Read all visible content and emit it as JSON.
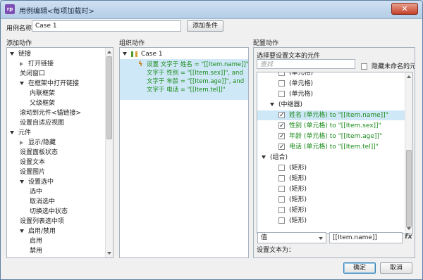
{
  "window": {
    "title": "用例编辑<每项加载时>",
    "app_icon": "rp",
    "close_glyph": "✕"
  },
  "case": {
    "name_label": "用例名称",
    "name_value": "Case 1",
    "add_condition": "添加条件"
  },
  "sections": {
    "add_action": "添加动作",
    "organize_action": "组织动作",
    "configure_action": "配置动作"
  },
  "actions_tree": [
    {
      "label": "链接",
      "level": 0,
      "toggle": "down"
    },
    {
      "label": "打开链接",
      "level": 1,
      "toggle": "right"
    },
    {
      "label": "关闭窗口",
      "level": 1,
      "toggle": "none"
    },
    {
      "label": "在框架中打开链接",
      "level": 1,
      "toggle": "down"
    },
    {
      "label": "内联框架",
      "level": 2,
      "toggle": "none"
    },
    {
      "label": "父级框架",
      "level": 2,
      "toggle": "none"
    },
    {
      "label": "滚动到元件<锚链接>",
      "level": 1,
      "toggle": "none"
    },
    {
      "label": "设置自适应视图",
      "level": 1,
      "toggle": "none"
    },
    {
      "label": "元件",
      "level": 0,
      "toggle": "down"
    },
    {
      "label": "显示/隐藏",
      "level": 1,
      "toggle": "right"
    },
    {
      "label": "设置面板状态",
      "level": 1,
      "toggle": "none"
    },
    {
      "label": "设置文本",
      "level": 1,
      "toggle": "none"
    },
    {
      "label": "设置图片",
      "level": 1,
      "toggle": "none"
    },
    {
      "label": "设置选中",
      "level": 1,
      "toggle": "down"
    },
    {
      "label": "选中",
      "level": 2,
      "toggle": "none"
    },
    {
      "label": "取消选中",
      "level": 2,
      "toggle": "none"
    },
    {
      "label": "切换选中状态",
      "level": 2,
      "toggle": "none"
    },
    {
      "label": "设置列表选中项",
      "level": 1,
      "toggle": "none"
    },
    {
      "label": "启用/禁用",
      "level": 1,
      "toggle": "down"
    },
    {
      "label": "启用",
      "level": 2,
      "toggle": "none"
    },
    {
      "label": "禁用",
      "level": 2,
      "toggle": "none"
    }
  ],
  "organize": {
    "case_label": "Case 1",
    "action_lines": [
      "设置 文字于 姓名 = \"[[Item.name]]\", and",
      "文字于 性别 = \"[[Item.sex]]\", and",
      "文字于 年龄 = \"[[Item.age]]\", and",
      "文字于 电话 = \"[[Item.tel]]\""
    ]
  },
  "configure": {
    "select_label": "选择要设置文本的元件",
    "search_placeholder": "查找",
    "hide_unnamed": "隐藏未命名的元件",
    "items": [
      {
        "label": "(单元格)",
        "level": 2,
        "checkbox": true,
        "checked": false,
        "partial": true
      },
      {
        "label": "(单元格)",
        "level": 2,
        "checkbox": true,
        "checked": false
      },
      {
        "label": "(单元格)",
        "level": 2,
        "checkbox": true,
        "checked": false
      },
      {
        "label": "(中继器)",
        "level": 1,
        "checkbox": false,
        "toggle": "down"
      },
      {
        "label": "姓名 (单元格) to \"[[Item.name]]\"",
        "level": 2,
        "checkbox": true,
        "checked": true,
        "selected": true
      },
      {
        "label": "性别 (单元格) to \"[[Item.sex]]\"",
        "level": 2,
        "checkbox": true,
        "checked": true
      },
      {
        "label": "年龄 (单元格) to \"[[Item.age]]\"",
        "level": 2,
        "checkbox": true,
        "checked": true
      },
      {
        "label": "电话 (单元格) to \"[[Item.tel]]\"",
        "level": 2,
        "checkbox": true,
        "checked": true
      },
      {
        "label": "(组合)",
        "level": 0,
        "checkbox": false,
        "toggle": "down"
      },
      {
        "label": "(矩形)",
        "level": 2,
        "checkbox": true,
        "checked": false
      },
      {
        "label": "(矩形)",
        "level": 2,
        "checkbox": true,
        "checked": false
      },
      {
        "label": "(矩形)",
        "level": 2,
        "checkbox": true,
        "checked": false
      },
      {
        "label": "(矩形)",
        "level": 2,
        "checkbox": true,
        "checked": false
      },
      {
        "label": "(矩形)",
        "level": 2,
        "checkbox": true,
        "checked": false
      },
      {
        "label": "(矩形)",
        "level": 2,
        "checkbox": true,
        "checked": false
      }
    ],
    "set_text_label": "设置文本为：",
    "type_value": "值",
    "value_text": "[[Item.name]]",
    "fx_label": "fx"
  },
  "footer": {
    "ok": "确定",
    "cancel": "取消"
  },
  "colors": {
    "selected_row": "#cfe8f7",
    "green_text": "#1a8a1a"
  }
}
